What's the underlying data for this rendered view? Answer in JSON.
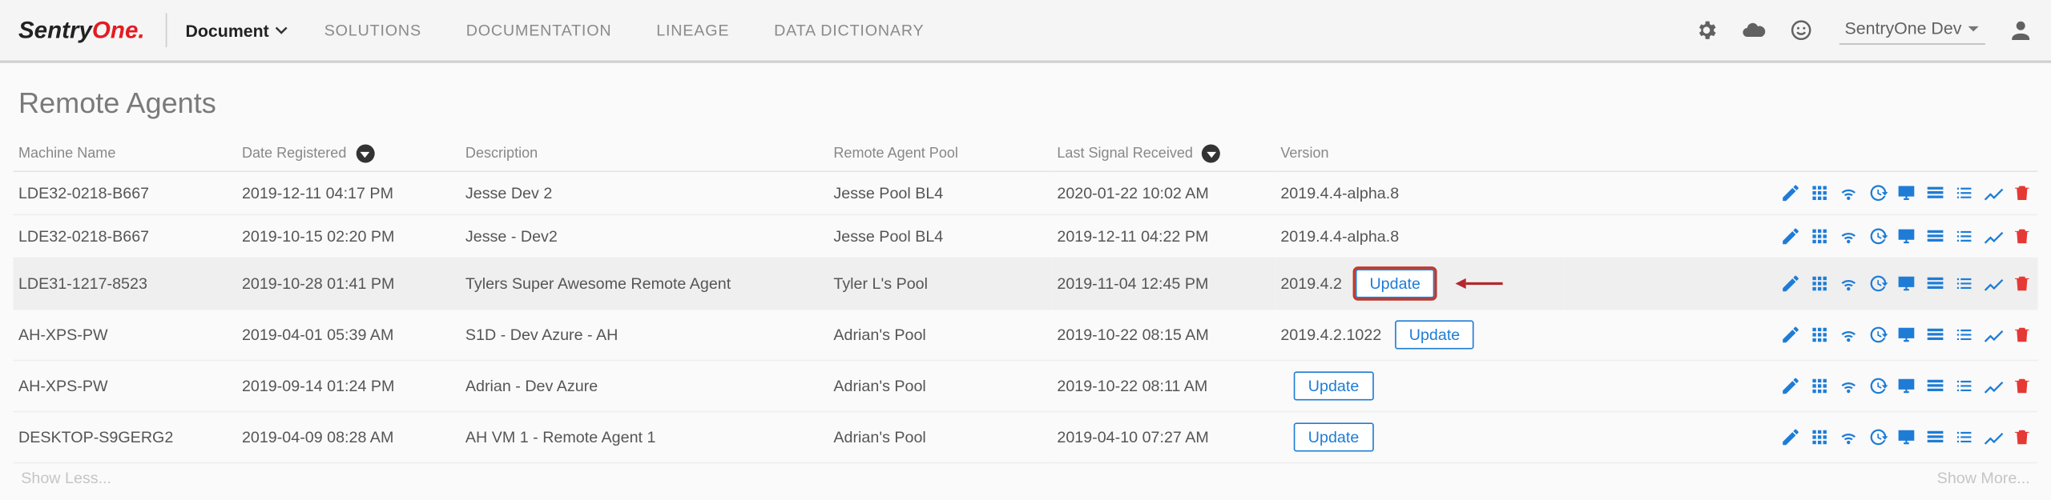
{
  "header": {
    "logo_main": "Sentry",
    "logo_accent": "One",
    "dropdown_label": "Document",
    "nav": [
      "SOLUTIONS",
      "DOCUMENTATION",
      "LINEAGE",
      "DATA DICTIONARY"
    ],
    "user_label": "SentryOne Dev"
  },
  "page_title": "Remote Agents",
  "columns": {
    "machine": "Machine Name",
    "registered": "Date Registered",
    "description": "Description",
    "pool": "Remote Agent Pool",
    "signal": "Last Signal Received",
    "version": "Version"
  },
  "update_label": "Update",
  "rows": [
    {
      "machine": "LDE32-0218-B667",
      "registered": "2019-12-11 04:17 PM",
      "description": "Jesse Dev 2",
      "pool": "Jesse Pool BL4",
      "signal": "2020-01-22 10:02 AM",
      "version": "2019.4.4-alpha.8",
      "show_update": false,
      "highlight": false,
      "hover": false
    },
    {
      "machine": "LDE32-0218-B667",
      "registered": "2019-10-15 02:20 PM",
      "description": "Jesse - Dev2",
      "pool": "Jesse Pool BL4",
      "signal": "2019-12-11 04:22 PM",
      "version": "2019.4.4-alpha.8",
      "show_update": false,
      "highlight": false,
      "hover": false
    },
    {
      "machine": "LDE31-1217-8523",
      "registered": "2019-10-28 01:41 PM",
      "description": "Tylers Super Awesome Remote Agent",
      "pool": "Tyler L's Pool",
      "signal": "2019-11-04 12:45 PM",
      "version": "2019.4.2",
      "show_update": true,
      "highlight": true,
      "hover": true
    },
    {
      "machine": "AH-XPS-PW",
      "registered": "2019-04-01 05:39 AM",
      "description": "S1D - Dev Azure - AH",
      "pool": "Adrian's Pool",
      "signal": "2019-10-22 08:15 AM",
      "version": "2019.4.2.1022",
      "show_update": true,
      "highlight": false,
      "hover": false
    },
    {
      "machine": "AH-XPS-PW",
      "registered": "2019-09-14 01:24 PM",
      "description": "Adrian - Dev Azure",
      "pool": "Adrian's Pool",
      "signal": "2019-10-22 08:11 AM",
      "version": "",
      "show_update": true,
      "highlight": false,
      "hover": false
    },
    {
      "machine": "DESKTOP-S9GERG2",
      "registered": "2019-04-09 08:28 AM",
      "description": "AH VM 1 - Remote Agent 1",
      "pool": "Adrian's Pool",
      "signal": "2019-04-10 07:27 AM",
      "version": "",
      "show_update": true,
      "highlight": false,
      "hover": false
    }
  ],
  "footer": {
    "less": "Show Less...",
    "more": "Show More..."
  }
}
